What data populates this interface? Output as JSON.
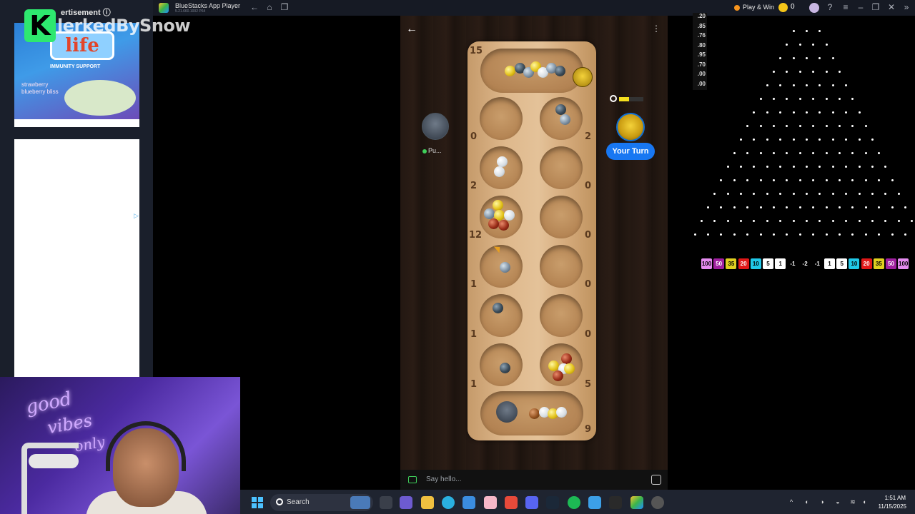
{
  "ad": {
    "label": "ertisement ⓘ",
    "brand": "life",
    "tagline": "IMMUNITY SUPPORT",
    "flavor": "strawberry blueberry bliss"
  },
  "stream": {
    "logo_letter": "K",
    "channel_name": "lerkedBySnow"
  },
  "titlebar": {
    "app_title": "BlueStacks App Player",
    "app_subtitle": "5.21.660.1002 P64",
    "play_win": "Play & Win",
    "coin_count": "0"
  },
  "game": {
    "opponent_name": "Pu...",
    "your_turn_label": "Your Turn",
    "opponent_store_count": "15",
    "player_store_count": "9",
    "left_pit_counts": [
      "0",
      "2",
      "12",
      "1",
      "1",
      "1"
    ],
    "right_pit_counts": [
      "2",
      "0",
      "0",
      "0",
      "0",
      "5"
    ],
    "timer_fraction": 0.4
  },
  "chat": {
    "placeholder": "Say hello..."
  },
  "plinko": {
    "multipliers": [
      ".20",
      ".85",
      ".76",
      ".80",
      ".95",
      ".70",
      ".00",
      ".00"
    ],
    "slots": [
      {
        "label": "100",
        "color": "#e58cf0"
      },
      {
        "label": "50",
        "color": "#a020a0"
      },
      {
        "label": "35",
        "color": "#e0d020"
      },
      {
        "label": "20",
        "color": "#e01818"
      },
      {
        "label": "10",
        "color": "#20c8e8"
      },
      {
        "label": "5",
        "color": "#ffffff"
      },
      {
        "label": "1",
        "color": "#ffffff"
      },
      {
        "label": "-1",
        "color": "#000000"
      },
      {
        "label": "-2",
        "color": "#000000"
      },
      {
        "label": "-1",
        "color": "#000000"
      },
      {
        "label": "1",
        "color": "#ffffff"
      },
      {
        "label": "5",
        "color": "#ffffff"
      },
      {
        "label": "10",
        "color": "#20c8e8"
      },
      {
        "label": "20",
        "color": "#e01818"
      },
      {
        "label": "35",
        "color": "#e0d020"
      },
      {
        "label": "50",
        "color": "#a020a0"
      },
      {
        "label": "100",
        "color": "#e58cf0"
      }
    ]
  },
  "webcam": {
    "neon_line1": "good",
    "neon_line2": "vibes",
    "neon_line3": "only"
  },
  "taskbar": {
    "search_label": "Search",
    "time": "1:51 AM",
    "date": "11/15/2025"
  }
}
